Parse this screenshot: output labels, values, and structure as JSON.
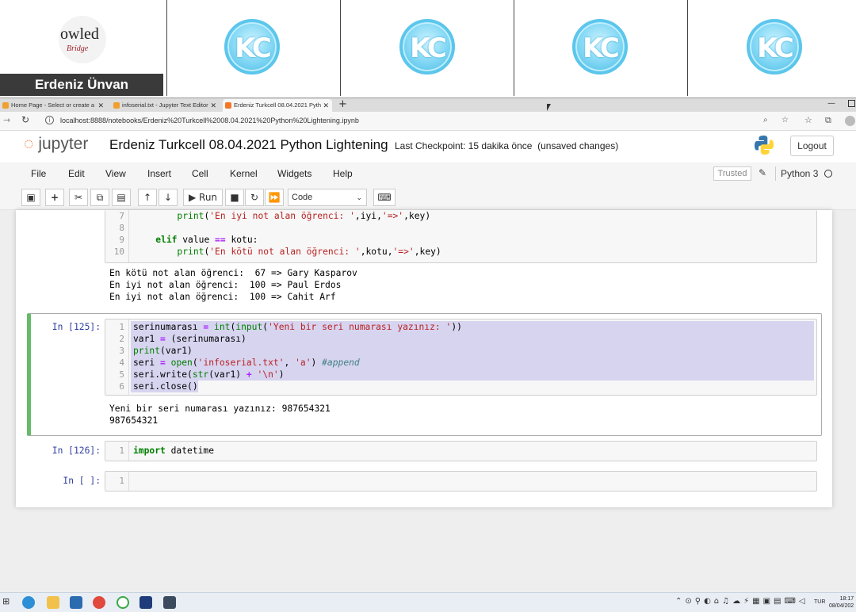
{
  "call": {
    "presenter_name": "Erdeniz Ünvan",
    "logo_text_top": "owled",
    "logo_text_bottom": "Bridge",
    "participant_badge": "KC"
  },
  "browser": {
    "tabs": [
      {
        "label": "Home Page - Select or create a"
      },
      {
        "label": "infoserial.txt - Jupyter Text Editor"
      },
      {
        "label": "Erdeniz Turkcell 08.04.2021 Pyth"
      }
    ],
    "new_tab": "+",
    "url": "localhost:8888/notebooks/Erdeniz%20Turkcell%2008.04.2021%20Python%20Lightening.ipynb"
  },
  "jupyter": {
    "logo": "jupyter",
    "notebook_title": "Erdeniz Turkcell 08.04.2021 Python Lightening",
    "checkpoint": "Last Checkpoint: 15 dakika önce",
    "unsaved": "(unsaved changes)",
    "logout": "Logout",
    "menus": [
      "File",
      "Edit",
      "View",
      "Insert",
      "Cell",
      "Kernel",
      "Widgets",
      "Help"
    ],
    "trusted": "Trusted",
    "kernel_name": "Python 3",
    "run_label": "Run",
    "cell_type": "Code"
  },
  "cells": {
    "prev": {
      "lines": [
        {
          "n": "7"
        },
        {
          "n": "8"
        },
        {
          "n": "9"
        },
        {
          "n": "10"
        }
      ],
      "output": [
        "En kötü not alan öğrenci:  67 => Gary Kasparov",
        "En iyi not alan öğrenci:  100 => Paul Erdos",
        "En iyi not alan öğrenci:  100 => Cahit Arf"
      ]
    },
    "c125": {
      "prompt": "In [125]:",
      "output": [
        "Yeni bir seri numarası yazınız: 987654321",
        "987654321"
      ]
    },
    "c126": {
      "prompt": "In [126]:"
    },
    "cempty": {
      "prompt": "In [ ]:"
    }
  },
  "taskbar": {
    "lang": "TUR",
    "time": "18:17",
    "date": "08/04/202"
  }
}
